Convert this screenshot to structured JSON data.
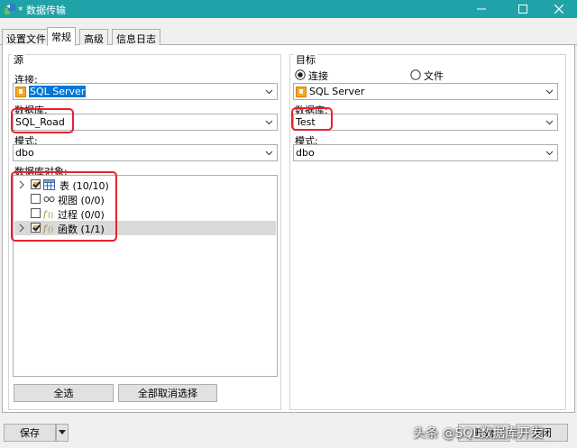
{
  "window": {
    "title": "* 数据传输",
    "accent": "#1fa3a8"
  },
  "tabs": [
    {
      "label": "设置文件"
    },
    {
      "label": "常规"
    },
    {
      "label": "高级"
    },
    {
      "label": "信息日志"
    }
  ],
  "source": {
    "title": "源",
    "connection_label": "连接:",
    "connection_value": "SQL Server",
    "database_label": "数据库:",
    "database_value": "SQL_Road",
    "schema_label": "模式:",
    "schema_value": "dbo",
    "objects_label": "数据库对象:",
    "objects": [
      {
        "label": "表 (10/10)",
        "state": "checked",
        "expandable": true,
        "icon": "table-icon"
      },
      {
        "label": "视图 (0/0)",
        "state": "unchecked",
        "expandable": false,
        "icon": "view-icon"
      },
      {
        "label": "过程 (0/0)",
        "state": "unchecked",
        "expandable": false,
        "icon": "procedure-icon"
      },
      {
        "label": "函数 (1/1)",
        "state": "checked",
        "expandable": true,
        "icon": "function-icon"
      }
    ],
    "select_all_label": "全选",
    "deselect_all_label": "全部取消选择"
  },
  "target": {
    "title": "目标",
    "radio_connection_label": "连接",
    "radio_file_label": "文件",
    "radio_selected": "connection",
    "connection_value": "SQL Server",
    "database_label": "数据库:",
    "database_value": "Test",
    "schema_label": "模式:",
    "schema_value": "dbo"
  },
  "footer": {
    "save_label": "保存",
    "start_label": "开始",
    "close_label": "关闭"
  },
  "watermark": "头条 @SQL数据库开发",
  "highlight_color": "#e8212f"
}
